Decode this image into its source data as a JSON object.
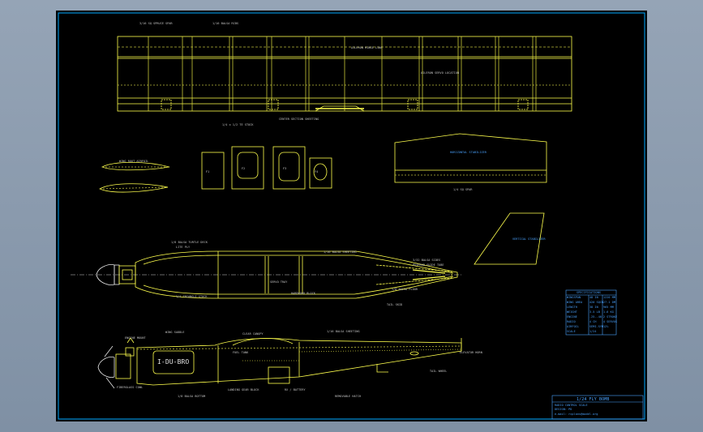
{
  "labels": {
    "top_wing_spar": "3/16 SQ SPRUCE SPAR",
    "top_wing_ribs": "1/16 BALSA RIBS",
    "top_wing_aileron": "AILERON HINGE LINE",
    "top_wing_servo": "AILERON SERVO LOCATION",
    "top_wing_trailing": "1/4 x 1/2 TE STOCK",
    "top_wing_center": "CENTER SECTION SHEETING",
    "airfoil_note": "WING ROOT AIRFOIL",
    "stab_note": "HORIZONTAL STABILIZER",
    "stab_spar": "1/4 SQ SPAR",
    "fin_note": "VERTICAL STABILIZER",
    "former_1": "F1",
    "former_2": "F2",
    "former_3": "F3",
    "former_4": "F4",
    "fuse_top_a": "1/8 BALSA TURTLE DECK",
    "fuse_top_b": "LITE PLY",
    "fuse_top_c": "1/16 BALSA SHEETING",
    "fuse_top_d": "3/32 BALSA SIDES",
    "fuse_top_e": "PUSHROD GUIDE TUBE",
    "fuse_top_f": "1/4 TRIANGLE STOCK",
    "fuse_top_g": "SERVO TRAY",
    "fuse_top_h": "HARDWOOD BLOCK",
    "fuse_top_i": "1/8 BALSA FLOOR",
    "fuse_top_j": "TAIL SKID",
    "side_engine": "ENGINE MOUNT",
    "side_cowl": "FIBERGLASS COWL",
    "side_canopy": "CLEAR CANOPY",
    "side_tank": "FUEL TANK",
    "side_wing": "WING SADDLE",
    "side_bottom": "1/8 BALSA BOTTOM",
    "side_rear": "1/16 BALSA SHEETING",
    "side_tail": "ELEVATOR HORN",
    "side_tailwheel": "TAIL WHEEL",
    "side_gear": "LANDING GEAR BLOCK",
    "side_servo": "RX / BATTERY",
    "side_hatch": "REMOVABLE HATCH",
    "registration": "I-DU-BRO",
    "title_main": "1/24 FLY BOMB",
    "title_sub1": "RADIO CONTROL SCALE",
    "title_sub2": "DESIGN: PD",
    "title_sub3": "e-mail: rcplans@model.org"
  },
  "spec_table": {
    "header": "SPECIFICATIONS",
    "rows": [
      [
        "WINGSPAN",
        "48 IN",
        "1220 MM"
      ],
      [
        "WING AREA",
        "420 SQIN",
        "27.1 DM"
      ],
      [
        "LENGTH",
        "38 IN",
        "965 MM"
      ],
      [
        "WEIGHT",
        "3.5 LB",
        "1.6 KG"
      ],
      [
        "ENGINE",
        ".25-.40",
        "2 STROKE"
      ],
      [
        "RADIO",
        "4 CH",
        "4 SERVOS"
      ],
      [
        "AIRFOIL",
        "SEMI-SYM",
        "12%"
      ],
      [
        "SCALE",
        "1/24",
        ""
      ]
    ]
  },
  "colors": {
    "sheet": "#000000",
    "frame": "#00a8ff",
    "line_yellow": "#ffff4d",
    "line_white": "#d8d8d8",
    "line_blue": "#4aa3ff"
  }
}
